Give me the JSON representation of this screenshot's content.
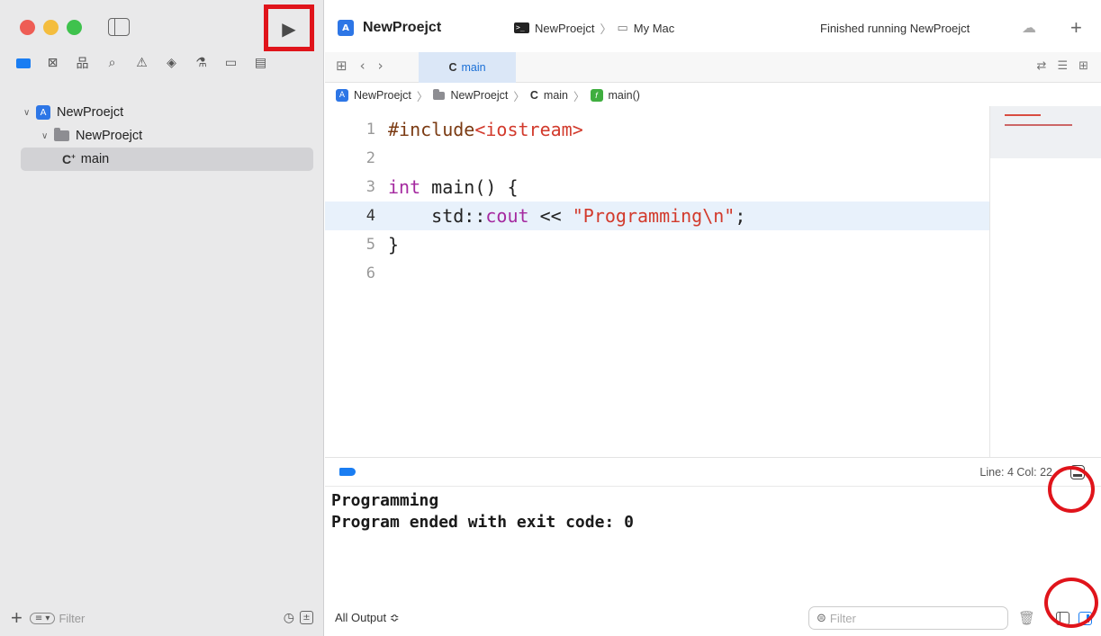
{
  "sidebar": {
    "tree": {
      "project": "NewProejct",
      "group": "NewProejct",
      "file_prefix": "C",
      "file_suffix": "+",
      "file": "main"
    },
    "filter_placeholder": "Filter",
    "nav_icons": [
      "folder-icon",
      "x-square-icon",
      "hierarchy-icon",
      "search-icon",
      "warning-icon",
      "diamond-icon",
      "spray-icon",
      "tag-icon",
      "list-icon"
    ]
  },
  "toolbar": {
    "project_name": "NewProejct",
    "scheme_target": "NewProejct",
    "scheme_arrow": "〉",
    "destination": "My Mac",
    "status": "Finished running NewProejct"
  },
  "tab": {
    "prefix": "C",
    "label": "main"
  },
  "breadcrumb": {
    "project": "NewProejct",
    "group": "NewProejct",
    "file": "main",
    "symbol": "main()"
  },
  "editor": {
    "line_numbers": [
      "1",
      "2",
      "3",
      "4",
      "5",
      "6"
    ],
    "line1_pre": "#include ",
    "line1_str": "<iostream>",
    "line3_kw": "int",
    "line3_rest": " main() {",
    "line4_ns": "std::",
    "line4_kw": "cout",
    "line4_op": " << ",
    "line4_str": "\"Programming\\n\"",
    "line4_end": ";",
    "line5": "}"
  },
  "debugbar": {
    "line_col": "Line: 4  Col: 22"
  },
  "console": {
    "line1": "Programming",
    "line2": "Program ended with exit code: 0"
  },
  "output": {
    "selector": "All Output ≎",
    "filter_placeholder": "Filter"
  },
  "colors": {
    "accent": "#1a7df2",
    "highlight_red": "#e0141b"
  }
}
